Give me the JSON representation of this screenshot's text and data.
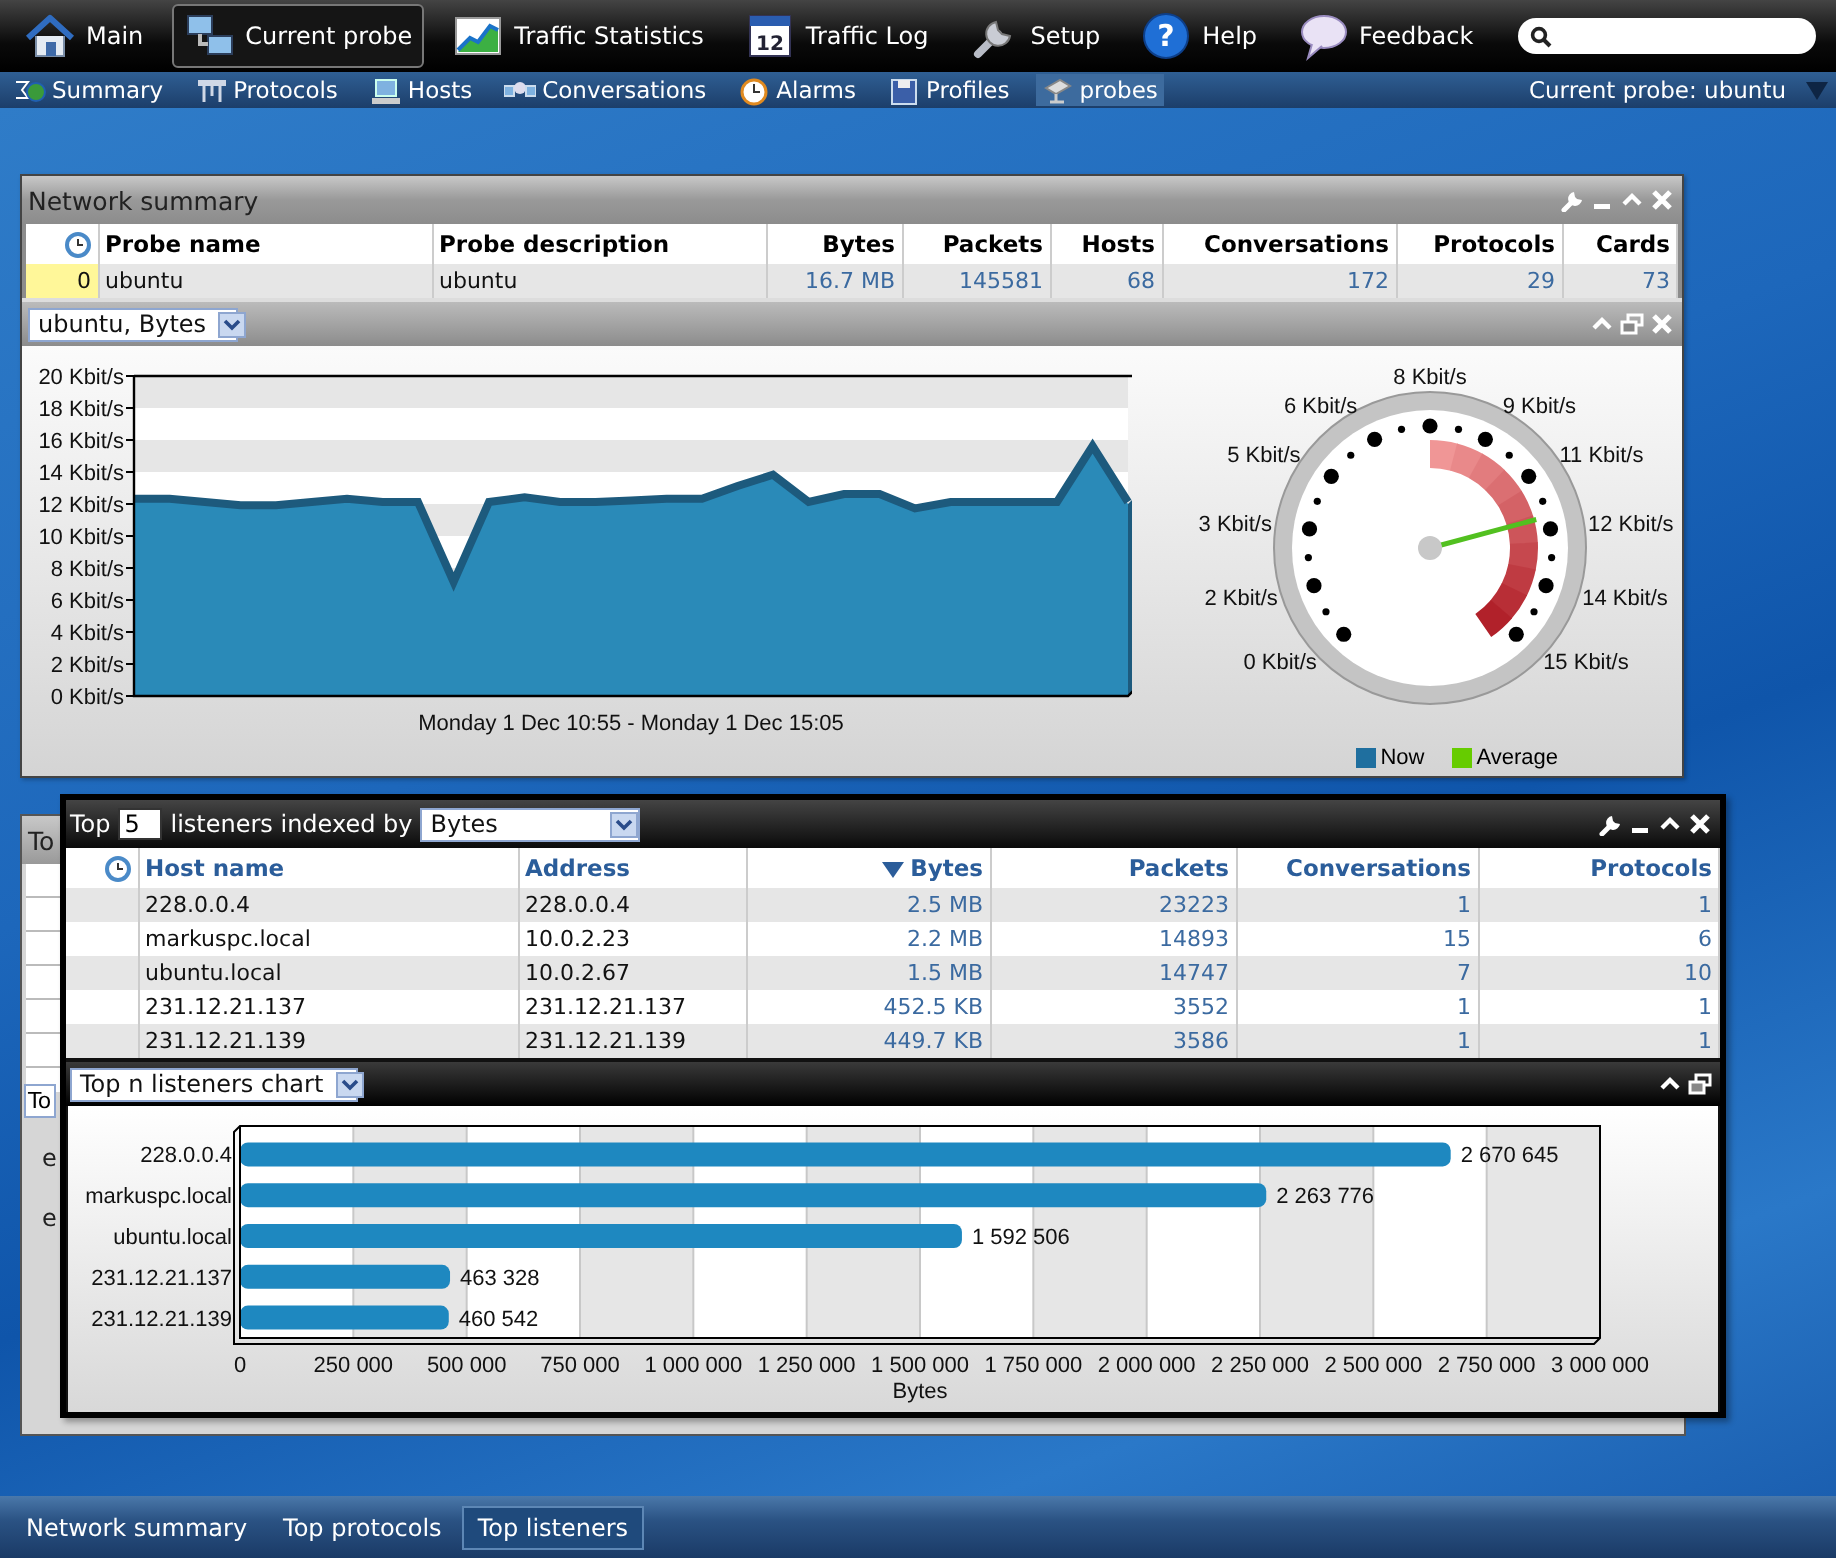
{
  "menu": {
    "items": [
      {
        "kind": "home",
        "label": "Main",
        "selected": false
      },
      {
        "kind": "probe",
        "label": "Current probe",
        "selected": true
      },
      {
        "kind": "stats",
        "label": "Traffic Statistics",
        "selected": false
      },
      {
        "kind": "calendar",
        "label": "Traffic Log",
        "glyph": "12",
        "selected": false
      },
      {
        "kind": "setup",
        "label": "Setup",
        "selected": false
      },
      {
        "kind": "help",
        "label": "Help",
        "glyph": "?",
        "selected": false
      },
      {
        "kind": "feedback",
        "label": "Feedback",
        "selected": false
      }
    ]
  },
  "submenu": {
    "items": [
      {
        "kind": "summary",
        "label": "Summary",
        "selected": false
      },
      {
        "kind": "protocols",
        "label": "Protocols",
        "selected": false
      },
      {
        "kind": "hosts",
        "label": "Hosts",
        "selected": false
      },
      {
        "kind": "conversations",
        "label": "Conversations",
        "selected": false
      },
      {
        "kind": "alarms",
        "label": "Alarms",
        "selected": false
      },
      {
        "kind": "profiles",
        "label": "Profiles",
        "selected": false
      },
      {
        "kind": "probes",
        "label": "probes",
        "selected": true
      }
    ],
    "current_probe": "Current probe: ubuntu"
  },
  "network_summary": {
    "title": "Network summary",
    "table": {
      "columns": [
        "Probe name",
        "Probe description",
        "Bytes",
        "Packets",
        "Hosts",
        "Conversations",
        "Protocols",
        "Cards"
      ],
      "rows": [
        {
          "index": "0",
          "cells": [
            "ubuntu",
            "ubuntu",
            "16.7 MB",
            "145581",
            "68",
            "172",
            "29",
            "73"
          ]
        }
      ]
    },
    "chart_panel": {
      "selector": "ubuntu, Bytes",
      "chart_data": {
        "type": "area",
        "xlabel": "Monday 1 Dec 10:55 - Monday 1 Dec 15:05",
        "ylim": [
          0,
          20
        ],
        "yticks": [
          {
            "value": 0,
            "label": "0 Kbit/s"
          },
          {
            "value": 2,
            "label": "2 Kbit/s"
          },
          {
            "value": 4,
            "label": "4 Kbit/s"
          },
          {
            "value": 6,
            "label": "6 Kbit/s"
          },
          {
            "value": 8,
            "label": "8 Kbit/s"
          },
          {
            "value": 10,
            "label": "10 Kbit/s"
          },
          {
            "value": 12,
            "label": "12 Kbit/s"
          },
          {
            "value": 14,
            "label": "14 Kbit/s"
          },
          {
            "value": 16,
            "label": "16 Kbit/s"
          },
          {
            "value": 18,
            "label": "18 Kbit/s"
          },
          {
            "value": 20,
            "label": "20 Kbit/s"
          }
        ],
        "series": [
          {
            "color": "#2a8ab8",
            "values": [
              12.2,
              12.2,
              12.0,
              11.8,
              11.8,
              12.0,
              12.2,
              12.0,
              12.0,
              7.0,
              12.0,
              12.3,
              12.0,
              12.0,
              12.1,
              12.2,
              12.2,
              13.0,
              13.7,
              12.0,
              12.5,
              12.5,
              11.6,
              12.0,
              12.0,
              12.0,
              12.0,
              15.5,
              12.0
            ]
          }
        ]
      },
      "gauge": {
        "labels": [
          "8 Kbit/s",
          "6 Kbit/s",
          "9 Kbit/s",
          "5 Kbit/s",
          "11 Kbit/s",
          "3 Kbit/s",
          "12 Kbit/s",
          "2 Kbit/s",
          "14 Kbit/s",
          "0 Kbit/s",
          "15 Kbit/s"
        ]
      },
      "legend": [
        {
          "label": "Now",
          "color": "#1f6f9f"
        },
        {
          "label": "Average",
          "color": "#66cc00"
        }
      ]
    }
  },
  "background_window": {
    "title": "To",
    "selector": "To",
    "labels": [
      "e",
      "e"
    ]
  },
  "top_listeners": {
    "prefix": "Top",
    "count": "5",
    "middle": "listeners indexed by",
    "index_by": "Bytes",
    "table": {
      "columns": [
        {
          "label": "Host name",
          "sorted": false
        },
        {
          "label": "Address",
          "sorted": false
        },
        {
          "label": "Bytes",
          "sorted": true
        },
        {
          "label": "Packets",
          "sorted": false
        },
        {
          "label": "Conversations",
          "sorted": false
        },
        {
          "label": "Protocols",
          "sorted": false
        }
      ],
      "rows": [
        [
          "228.0.0.4",
          "228.0.0.4",
          "2.5 MB",
          "23223",
          "1",
          "1"
        ],
        [
          "markuspc.local",
          "10.0.2.23",
          "2.2 MB",
          "14893",
          "15",
          "6"
        ],
        [
          "ubuntu.local",
          "10.0.2.67",
          "1.5 MB",
          "14747",
          "7",
          "10"
        ],
        [
          "231.12.21.137",
          "231.12.21.137",
          "452.5 KB",
          "3552",
          "1",
          "1"
        ],
        [
          "231.12.21.139",
          "231.12.21.139",
          "449.7 KB",
          "3586",
          "1",
          "1"
        ]
      ]
    },
    "chart_panel": {
      "selector": "Top n listeners chart",
      "chart_data": {
        "type": "bar",
        "orientation": "horizontal",
        "xlabel": "Bytes",
        "categories": [
          "228.0.0.4",
          "markuspc.local",
          "ubuntu.local",
          "231.12.21.137",
          "231.12.21.139"
        ],
        "grid": true,
        "series": [
          {
            "color": "#1e88c0",
            "values": [
              2670645,
              2263776,
              1592506,
              463328,
              460542
            ]
          }
        ],
        "xlim": [
          0,
          3000000
        ],
        "xticks": [
          {
            "value": 0,
            "label": "0"
          },
          {
            "value": 250000,
            "label": "250 000"
          },
          {
            "value": 500000,
            "label": "500 000"
          },
          {
            "value": 750000,
            "label": "750 000"
          },
          {
            "value": 1000000,
            "label": "1 000 000"
          },
          {
            "value": 1250000,
            "label": "1 250 000"
          },
          {
            "value": 1500000,
            "label": "1 500 000"
          },
          {
            "value": 1750000,
            "label": "1 750 000"
          },
          {
            "value": 2000000,
            "label": "2 000 000"
          },
          {
            "value": 2250000,
            "label": "2 250 000"
          },
          {
            "value": 2500000,
            "label": "2 500 000"
          },
          {
            "value": 2750000,
            "label": "2 750 000"
          },
          {
            "value": 3000000,
            "label": "3 000 000"
          }
        ],
        "value_labels": [
          "2 670 645",
          "2 263 776",
          "1 592 506",
          "463 328",
          "460 542"
        ]
      }
    }
  },
  "taskbar": {
    "tabs": [
      {
        "label": "Network summary",
        "selected": false
      },
      {
        "label": "Top protocols",
        "selected": false
      },
      {
        "label": "Top listeners",
        "selected": true
      }
    ]
  }
}
